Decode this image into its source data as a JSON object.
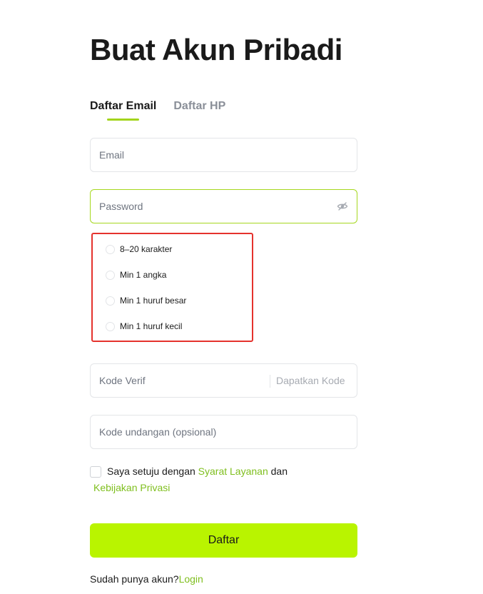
{
  "page": {
    "title": "Buat Akun Pribadi"
  },
  "tabs": [
    {
      "label": "Daftar Email",
      "active": true
    },
    {
      "label": "Daftar HP",
      "active": false
    }
  ],
  "form": {
    "email": {
      "placeholder": "Email",
      "value": ""
    },
    "password": {
      "placeholder": "Password",
      "value": "",
      "toggle_icon": "eye-slash-icon"
    },
    "password_rules": [
      "8–20 karakter",
      "Min 1 angka",
      "Min 1 huruf besar",
      "Min 1 huruf kecil"
    ],
    "verify_code": {
      "placeholder": "Kode Verif",
      "value": "",
      "action_label": "Dapatkan Kode"
    },
    "invite_code": {
      "placeholder": "Kode undangan (opsional)",
      "value": ""
    }
  },
  "agreement": {
    "prefix": "Saya setuju dengan ",
    "terms_link": "Syarat Layanan",
    "conjunction": " dan",
    "privacy_link": "Kebijakan Privasi",
    "checked": false
  },
  "submit_label": "Daftar",
  "footer": {
    "prompt": "Sudah punya akun?",
    "login_link": "Login"
  },
  "colors": {
    "accent": "#b9f400",
    "link": "#7fbf1e",
    "focus_border": "#a6d81f",
    "highlight_box": "#e5322d"
  }
}
